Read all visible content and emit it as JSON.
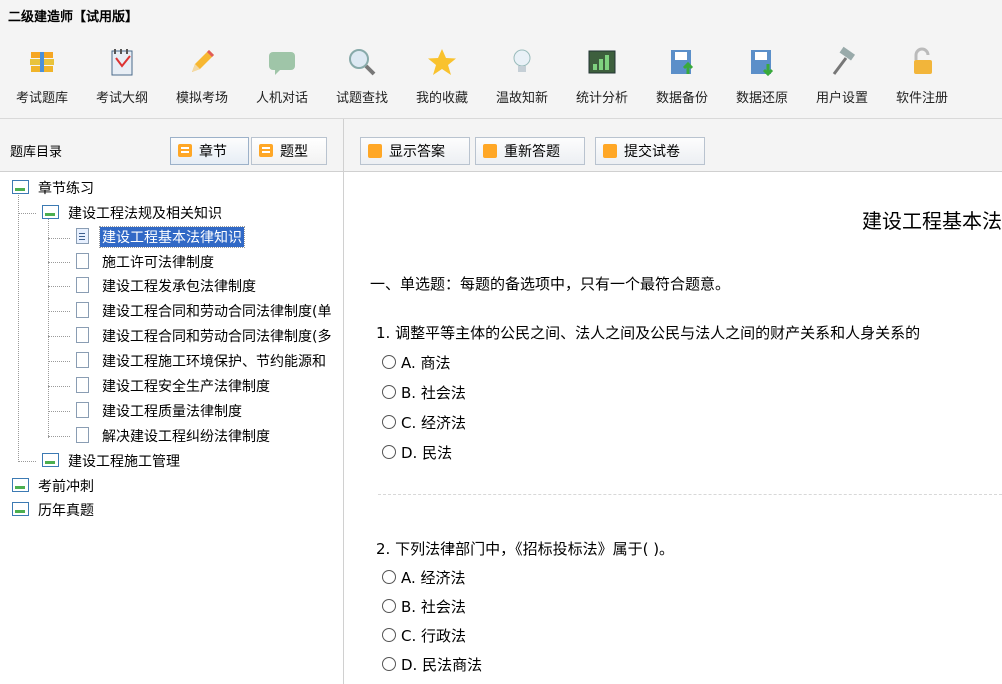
{
  "app": {
    "title": "二级建造师【试用版】"
  },
  "toolbar": [
    {
      "label": "考试题库",
      "icon": "books-icon"
    },
    {
      "label": "考试大纲",
      "icon": "notebook-icon"
    },
    {
      "label": "模拟考场",
      "icon": "pencil-icon"
    },
    {
      "label": "人机对话",
      "icon": "chat-bubble-icon"
    },
    {
      "label": "试题查找",
      "icon": "magnifier-icon"
    },
    {
      "label": "我的收藏",
      "icon": "star-icon"
    },
    {
      "label": "温故知新",
      "icon": "lightbulb-icon"
    },
    {
      "label": "统计分析",
      "icon": "chart-icon"
    },
    {
      "label": "数据备份",
      "icon": "backup-icon"
    },
    {
      "label": "数据还原",
      "icon": "restore-icon"
    },
    {
      "label": "用户设置",
      "icon": "hammer-icon"
    },
    {
      "label": "软件注册",
      "icon": "lock-icon"
    }
  ],
  "left_panel": {
    "title": "题库目录",
    "tab_chapter": "章节",
    "tab_type": "题型"
  },
  "answer_bar": {
    "show_answer": "显示答案",
    "redo": "重新答题",
    "submit": "提交试卷"
  },
  "tree": {
    "n0": "章节练习",
    "n1": "建设工程法规及相关知识",
    "n2": "建设工程基本法律知识",
    "n3": "施工许可法律制度",
    "n4": "建设工程发承包法律制度",
    "n5": "建设工程合同和劳动合同法律制度(单",
    "n6": "建设工程合同和劳动合同法律制度(多",
    "n7": "建设工程施工环境保护、节约能源和",
    "n8": "建设工程安全生产法律制度",
    "n9": "建设工程质量法律制度",
    "n10": "解决建设工程纠纷法律制度",
    "n11": "建设工程施工管理",
    "n12": "考前冲刺",
    "n13": "历年真题"
  },
  "content": {
    "doc_title": "建设工程基本法",
    "section": "一、单选题：每题的备选项中，只有一个最符合题意。",
    "q1": {
      "text": "1. 调整平等主体的公民之间、法人之间及公民与法人之间的财产关系和人身关系的",
      "options": [
        "A. 商法",
        "B. 社会法",
        "C. 经济法",
        "D. 民法"
      ]
    },
    "q2": {
      "text": "2. 下列法律部门中，《招标投标法》属于( )。",
      "options": [
        "A. 经济法",
        "B. 社会法",
        "C. 行政法",
        "D. 民法商法"
      ]
    }
  },
  "colors": {
    "selection": "#3169c6",
    "accent_icon": "#ffa726"
  }
}
